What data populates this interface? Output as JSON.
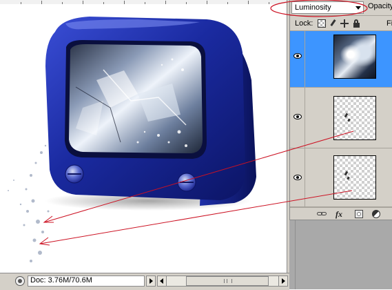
{
  "layers_panel": {
    "blend_mode": "Luminosity",
    "opacity_label": "Opacity:",
    "lock_label": "Lock:",
    "fill_label": "Fill:",
    "lock_icons": [
      "lock-transparent-pixels-icon",
      "lock-image-pixels-icon",
      "lock-position-icon",
      "lock-all-icon"
    ],
    "layers": [
      {
        "thumbnail": "tv-screen-photo",
        "visible": true,
        "selected": true
      },
      {
        "thumbnail": "transparent-splash-fragments",
        "visible": true,
        "selected": false
      },
      {
        "thumbnail": "transparent-splash-fragments",
        "visible": true,
        "selected": false
      }
    ],
    "footer_icons": [
      "link-layers-icon",
      "fx-layer-style-icon",
      "layer-mask-icon",
      "adjustment-layer-icon"
    ],
    "footer_fx": "fx"
  },
  "status_bar": {
    "doc_info": "Doc: 3.76M/70.6M"
  },
  "colors": {
    "selection": "#3d95ff",
    "annotation": "#cc1122",
    "panel_bg": "#d4d0c8",
    "tv_body": "#1c2c9e"
  }
}
